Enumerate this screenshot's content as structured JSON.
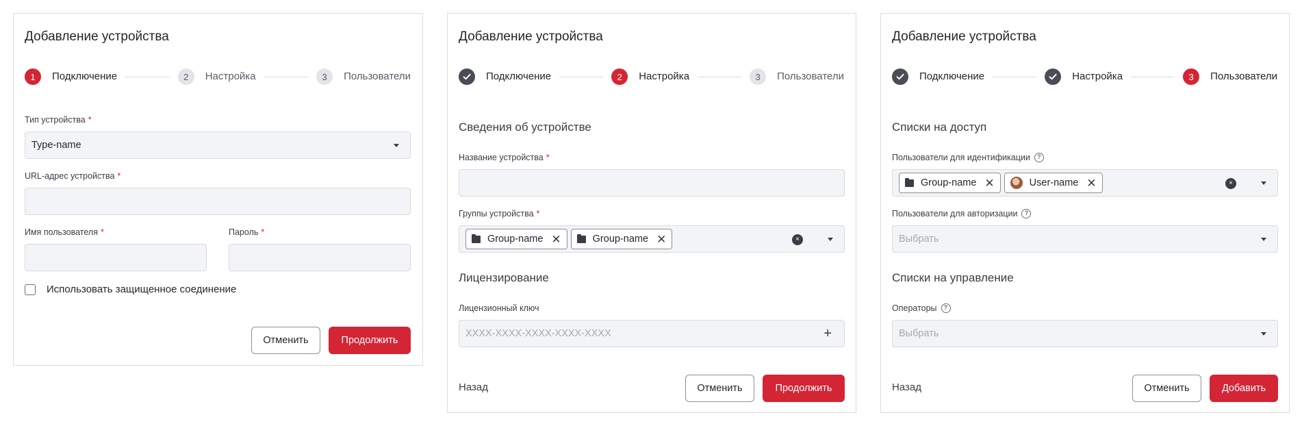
{
  "panels": [
    {
      "title": "Добавление устройства",
      "steps": [
        {
          "number": "1",
          "label": "Подключение",
          "state": "active"
        },
        {
          "number": "2",
          "label": "Настройка",
          "state": "pending"
        },
        {
          "number": "3",
          "label": "Пользователи",
          "state": "pending"
        }
      ],
      "device_type_label": "Тип устройства",
      "device_type_value": "Type-name",
      "url_label": "URL-адрес устройства",
      "url_value": "",
      "username_label": "Имя пользователя",
      "password_label": "Пароль",
      "secure_checkbox_label": "Использовать защищенное соединение",
      "secure_checkbox_checked": false,
      "cancel_label": "Отменить",
      "continue_label": "Продолжить",
      "required_mark": "*"
    },
    {
      "title": "Добавление устройства",
      "steps": [
        {
          "number": "1",
          "label": "Подключение",
          "state": "done"
        },
        {
          "number": "2",
          "label": "Настройка",
          "state": "active"
        },
        {
          "number": "3",
          "label": "Пользователи",
          "state": "pending"
        }
      ],
      "details_section": "Сведения об устройстве",
      "device_name_label": "Название устройства",
      "device_groups_label": "Группы устройства",
      "device_groups": [
        "Group-name",
        "Group-name"
      ],
      "licensing_section": "Лицензирование",
      "license_key_label": "Лицензионный ключ",
      "license_key_placeholder": "XXXX-XXXX-XXXX-XXXX-XXXX",
      "back_label": "Назад",
      "cancel_label": "Отменить",
      "continue_label": "Продолжить",
      "required_mark": "*"
    },
    {
      "title": "Добавление устройства",
      "steps": [
        {
          "number": "1",
          "label": "Подключение",
          "state": "done"
        },
        {
          "number": "2",
          "label": "Настройка",
          "state": "done"
        },
        {
          "number": "3",
          "label": "Пользователи",
          "state": "active"
        }
      ],
      "access_section": "Списки на доступ",
      "ident_users_label": "Пользователи для идентификации",
      "ident_chips": [
        {
          "kind": "group",
          "label": "Group-name"
        },
        {
          "kind": "user",
          "label": "User-name"
        }
      ],
      "auth_users_label": "Пользователи для авторизации",
      "auth_users_placeholder": "Выбрать",
      "management_section": "Списки на управление",
      "operators_label": "Операторы",
      "operators_placeholder": "Выбрать",
      "back_label": "Назад",
      "cancel_label": "Отменить",
      "add_label": "Добавить"
    }
  ],
  "icons": {
    "help": "?",
    "clear": "×",
    "chip_remove": "✕",
    "plus": "+"
  },
  "colors": {
    "accent": "#d42535",
    "step_done": "#4a4d55",
    "step_pending": "#e3e4e8",
    "field_bg": "#f3f4f7",
    "border": "#d9dbe0"
  }
}
